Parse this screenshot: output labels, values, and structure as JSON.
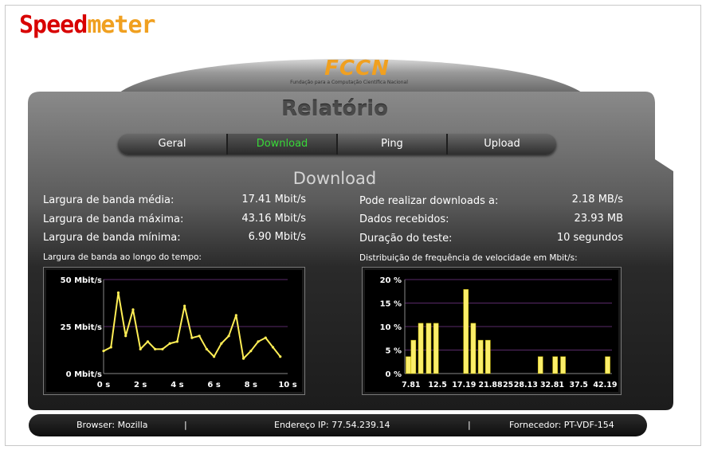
{
  "logo": {
    "part1": "Speed",
    "part2": "meter"
  },
  "org": {
    "mark": "FCCN",
    "subtitle": "Fundação para a Computação Científica Nacional"
  },
  "report_title": "Relatório",
  "tabs": [
    {
      "label": "Geral",
      "active": false
    },
    {
      "label": "Download",
      "active": true
    },
    {
      "label": "Ping",
      "active": false
    },
    {
      "label": "Upload",
      "active": false
    }
  ],
  "section_title": "Download",
  "stats_left": [
    {
      "label": "Largura de banda média:",
      "value": "17.41 Mbit/s"
    },
    {
      "label": "Largura de banda máxima:",
      "value": "43.16 Mbit/s"
    },
    {
      "label": "Largura de banda mínima:",
      "value": "6.90 Mbit/s"
    }
  ],
  "stats_right": [
    {
      "label": "Pode realizar downloads a:",
      "value": "2.18 MB/s"
    },
    {
      "label": "Dados recebidos:",
      "value": "23.93 MB"
    },
    {
      "label": "Duração do teste:",
      "value": "10 segundos"
    }
  ],
  "colors": {
    "accent_active_tab": "#38d838",
    "series": "#ffee55",
    "panel": "#202020",
    "grid": "#5a2a6a"
  },
  "chart_data": [
    {
      "type": "line",
      "title": "Largura de banda ao longo do tempo:",
      "x": [
        0,
        0.4,
        0.8,
        1.2,
        1.6,
        2.0,
        2.4,
        2.8,
        3.2,
        3.6,
        4.0,
        4.4,
        4.8,
        5.2,
        5.6,
        6.0,
        6.4,
        6.8,
        7.2,
        7.6,
        8.0,
        8.4,
        8.8,
        9.2,
        9.6
      ],
      "y": [
        12,
        14,
        43,
        20,
        34,
        13,
        17,
        13,
        13,
        16,
        17,
        36,
        19,
        20,
        13,
        9,
        16,
        20,
        31,
        8,
        12,
        17,
        19,
        14,
        9
      ],
      "x_ticks": [
        "0 s",
        "2 s",
        "4 s",
        "6 s",
        "8 s",
        "10 s"
      ],
      "x_tick_values": [
        0,
        2,
        4,
        6,
        8,
        10
      ],
      "y_ticks": [
        "0 Mbit/s",
        "25 Mbit/s",
        "50 Mbit/s"
      ],
      "y_tick_values": [
        0,
        25,
        50
      ],
      "xlim": [
        0,
        10
      ],
      "ylim": [
        0,
        50
      ],
      "grid": true
    },
    {
      "type": "bar",
      "title": "Distribuição de frequência de velocidade em  Mbit/s:",
      "bar_starts": [
        6.9,
        7.8,
        9.1,
        10.5,
        11.8,
        13.1,
        14.4,
        15.7,
        17.1,
        18.4,
        19.7,
        21.0,
        22.4,
        23.7,
        25.0,
        26.3,
        27.7,
        29.0,
        30.3,
        31.6,
        32.9,
        34.3,
        35.6,
        36.9,
        38.2,
        39.5,
        40.9,
        42.2
      ],
      "values": [
        3.6,
        7.1,
        10.7,
        10.7,
        10.7,
        0,
        0,
        0,
        17.9,
        10.7,
        7.1,
        7.1,
        0,
        0,
        0,
        0,
        0,
        0,
        3.6,
        0,
        3.6,
        3.6,
        0,
        0,
        0,
        0,
        0,
        3.6
      ],
      "bar_width": 1.0,
      "x_ticks": [
        "7.81",
        "12.5",
        "17.19",
        "21.88",
        "25",
        "28.13",
        "32.81",
        "37.5",
        "42.19"
      ],
      "x_tick_values": [
        7.81,
        12.5,
        17.19,
        21.88,
        25,
        28.13,
        32.81,
        37.5,
        42.19
      ],
      "y_ticks": [
        "0 %",
        "5 %",
        "10 %",
        "15 %",
        "20 %"
      ],
      "y_tick_values": [
        0,
        5,
        10,
        15,
        20
      ],
      "xlim": [
        6.7,
        43.4
      ],
      "ylim": [
        0,
        20
      ],
      "grid": true
    }
  ],
  "footer": {
    "browser": "Browser: Mozilla",
    "ip": "Endereço IP: 77.54.239.14",
    "provider": "Fornecedor: PT-VDF-154",
    "separator": "|"
  }
}
